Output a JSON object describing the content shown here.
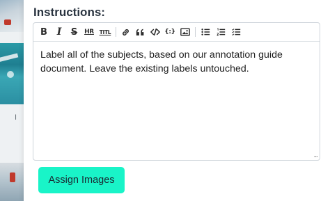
{
  "instructions": {
    "heading": "Instructions:",
    "content": "Label all of the subjects, based on our annotation guide document. Leave the existing labels untouched."
  },
  "toolbar": {
    "bold": "B",
    "italic": "I",
    "strikethrough": "S",
    "horizontal_rule": "HR",
    "title": "TITL",
    "code_block": "{:}",
    "icons": [
      "bold-icon",
      "italic-icon",
      "strikethrough-icon",
      "horizontal-rule-icon",
      "title-icon",
      "link-icon",
      "quote-icon",
      "code-icon",
      "code-block-icon",
      "image-icon",
      "bulleted-list-icon",
      "numbered-list-icon",
      "checklist-icon"
    ]
  },
  "editor": {
    "resize_handle": "..."
  },
  "background": {
    "partial_text": "I"
  },
  "actions": {
    "assign_label": "Assign Images",
    "assign_color": "#19f4c8"
  }
}
